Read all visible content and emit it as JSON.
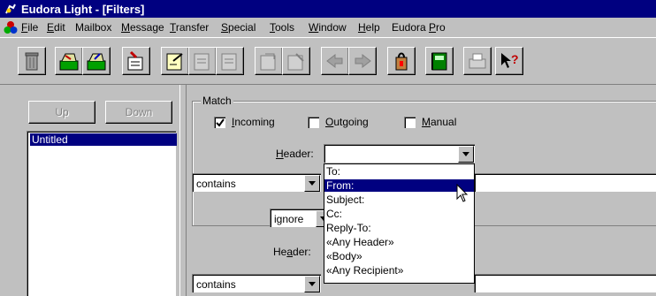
{
  "title": "Eudora Light - [Filters]",
  "menu": {
    "items": [
      {
        "label": "File",
        "u": "F"
      },
      {
        "label": "Edit",
        "u": "E"
      },
      {
        "label": "Mailbox",
        "u": ""
      },
      {
        "label": "Message",
        "u": "M"
      },
      {
        "label": "Transfer",
        "u": "T"
      },
      {
        "label": "Special",
        "u": "S"
      },
      {
        "label": "Tools",
        "u": "T"
      },
      {
        "label": "Window",
        "u": "W"
      },
      {
        "label": "Help",
        "u": "H"
      },
      {
        "label": "Eudora Pro",
        "u": "P"
      }
    ]
  },
  "toolbar": {
    "buttons": [
      "trash-icon",
      "check-mail-icon",
      "send-queued-icon",
      "new-message-icon",
      "reply-icon",
      "reply-all-icon",
      "forward-icon",
      "redirect-icon",
      "send-again-icon",
      "previous-message-icon",
      "next-message-icon",
      "attach-file-icon",
      "address-book-icon",
      "print-icon",
      "help-icon"
    ]
  },
  "filters": {
    "up_label": "Up",
    "down_label": "Down",
    "list": [
      "Untitled"
    ]
  },
  "match": {
    "group_label": "Match",
    "incoming_label": "Incoming",
    "incoming_checked": true,
    "outgoing_label": "Outgoing",
    "outgoing_checked": false,
    "manual_label": "Manual",
    "manual_checked": false,
    "header_label": "Header:",
    "header_value": "",
    "contains_1": "contains",
    "conjunction": "ignore",
    "header2_label": "Header:",
    "contains_2": "contains"
  },
  "header_dropdown": {
    "options": [
      "To:",
      "From:",
      "Subject:",
      "Cc:",
      "Reply-To:",
      "«Any Header»",
      "«Body»",
      "«Any Recipient»"
    ],
    "highlighted_index": 1
  }
}
